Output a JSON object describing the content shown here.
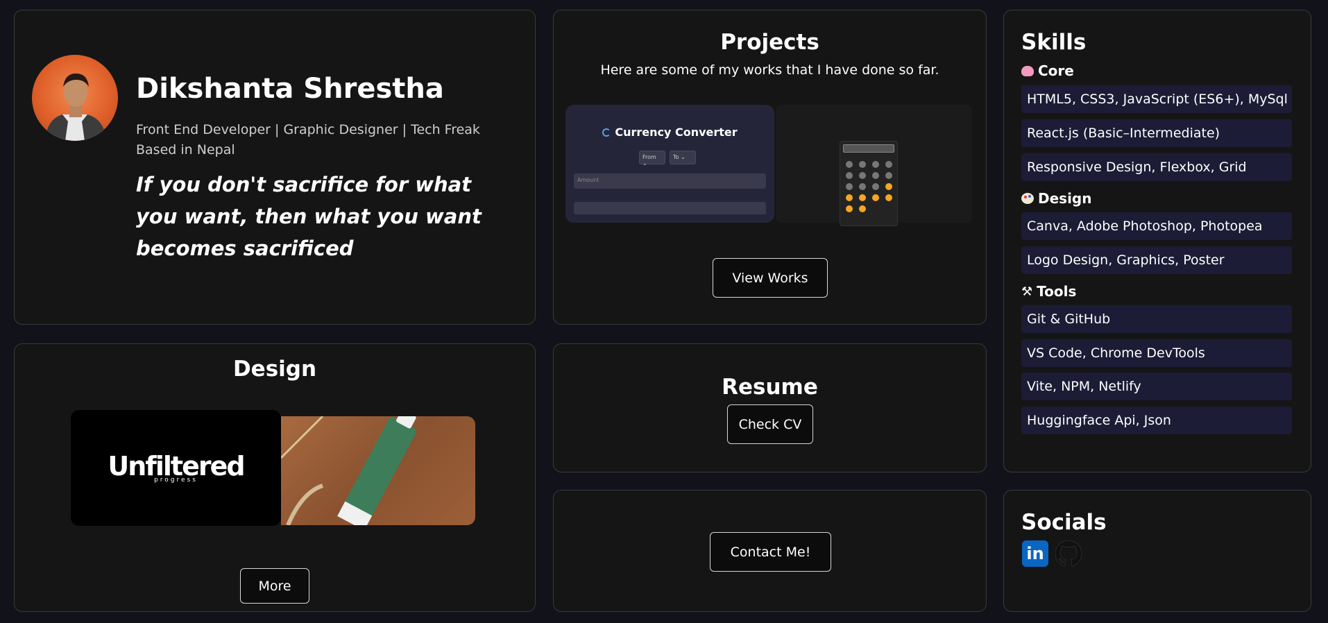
{
  "profile": {
    "name": "Dikshanta Shrestha",
    "roles": "Front End Developer | Graphic Designer | Tech Freak",
    "location": "Based in Nepal",
    "quote": "If you don't sacrifice for what you want, then what you want becomes sacrificed"
  },
  "projects": {
    "title": "Projects",
    "subtitle": "Here are some of my works that I have done so far.",
    "preview": {
      "app_title": "Currency Converter",
      "from_label": "From",
      "to_label": "To",
      "amount_placeholder": "Amount"
    },
    "button": "View Works"
  },
  "skills": {
    "title": "Skills",
    "groups": [
      {
        "heading": "Core",
        "icon": "brain-icon",
        "items": [
          "HTML5, CSS3, JavaScript (ES6+), MySql",
          "React.js (Basic–Intermediate)",
          "Responsive Design, Flexbox, Grid"
        ]
      },
      {
        "heading": "Design",
        "icon": "palette-icon",
        "items": [
          "Canva, Adobe Photoshop, Photopea",
          "Logo Design, Graphics, Poster"
        ]
      },
      {
        "heading": "Tools",
        "icon": "tools-icon",
        "items": [
          "Git & GitHub",
          "VS Code, Chrome DevTools",
          "Vite, NPM, Netlify",
          "Huggingface Api, Json"
        ]
      }
    ]
  },
  "design": {
    "title": "Design",
    "logo_word": "Unfiltered",
    "logo_sub": "progress",
    "button": "More"
  },
  "resume": {
    "title": "Resume",
    "button": "Check CV"
  },
  "contact": {
    "button": "Contact Me!"
  },
  "socials": {
    "title": "Socials",
    "icons": [
      "linkedin-icon",
      "github-icon"
    ]
  },
  "colors": {
    "background": "#12121a",
    "card": "#151515",
    "skill_item": "#1c1c36",
    "linkedin": "#0a66c2"
  }
}
